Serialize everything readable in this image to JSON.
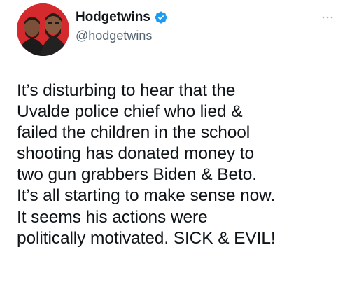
{
  "author": {
    "display_name": "Hodgetwins",
    "handle": "@hodgetwins",
    "verified": true,
    "avatar_icon": "profile-photo-two-men",
    "verified_icon": "verified-badge-icon"
  },
  "menu": {
    "more_icon": "more-options-icon"
  },
  "tweet": {
    "text": "It’s disturbing to hear that the\nUvalde police chief who lied &\nfailed the children in the school\nshooting has donated money to\ntwo gun grabbers Biden & Beto.\nIt’s all starting to make sense now.\nIt seems his actions were\npolitically motivated. SICK & EVIL!"
  },
  "colors": {
    "text": "#0f1419",
    "secondary_text": "#536471",
    "verified_blue": "#1d9bf0",
    "background": "#ffffff"
  }
}
